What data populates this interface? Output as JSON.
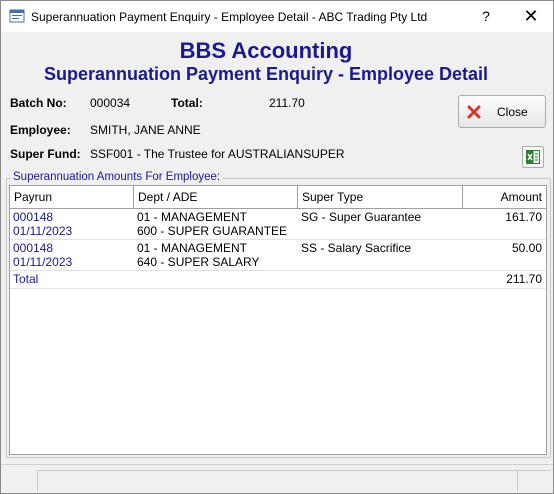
{
  "window": {
    "title": "Superannuation Payment Enquiry - Employee Detail - ABC Trading Pty Ltd",
    "help_label": "?",
    "close_label": "✕"
  },
  "header": {
    "company": "BBS Accounting",
    "subtitle": "Superannuation Payment Enquiry - Employee Detail"
  },
  "details": {
    "batch_label": "Batch No:",
    "batch_value": "000034",
    "total_label": "Total:",
    "total_value": "211.70",
    "employee_label": "Employee:",
    "employee_value": "SMITH, JANE ANNE",
    "fund_label": "Super Fund:",
    "fund_value": "SSF001 - The Trustee for AUSTRALIANSUPER"
  },
  "buttons": {
    "close_label": "Close",
    "close_icon": "red-x-icon",
    "export_icon": "excel-export-icon"
  },
  "group": {
    "legend": "Superannuation Amounts For Employee:"
  },
  "table": {
    "columns": [
      "Payrun",
      "Dept / ADE",
      "Super Type",
      "Amount"
    ],
    "rows": [
      {
        "payrun": "000148",
        "date": "01/11/2023",
        "dept": "01 - MANAGEMENT",
        "ade": "600 - SUPER GUARANTEE",
        "super_type": "SG - Super Guarantee",
        "amount": "161.70"
      },
      {
        "payrun": "000148",
        "date": "01/11/2023",
        "dept": "01 - MANAGEMENT",
        "ade": "640 - SUPER SALARY",
        "super_type": "SS - Salary Sacrifice",
        "amount": "50.00"
      }
    ],
    "total_label": "Total",
    "total_amount": "211.70"
  },
  "colors": {
    "accent": "#1a1a8c",
    "close_icon_red": "#d9342b",
    "excel_green": "#2e7d32"
  }
}
